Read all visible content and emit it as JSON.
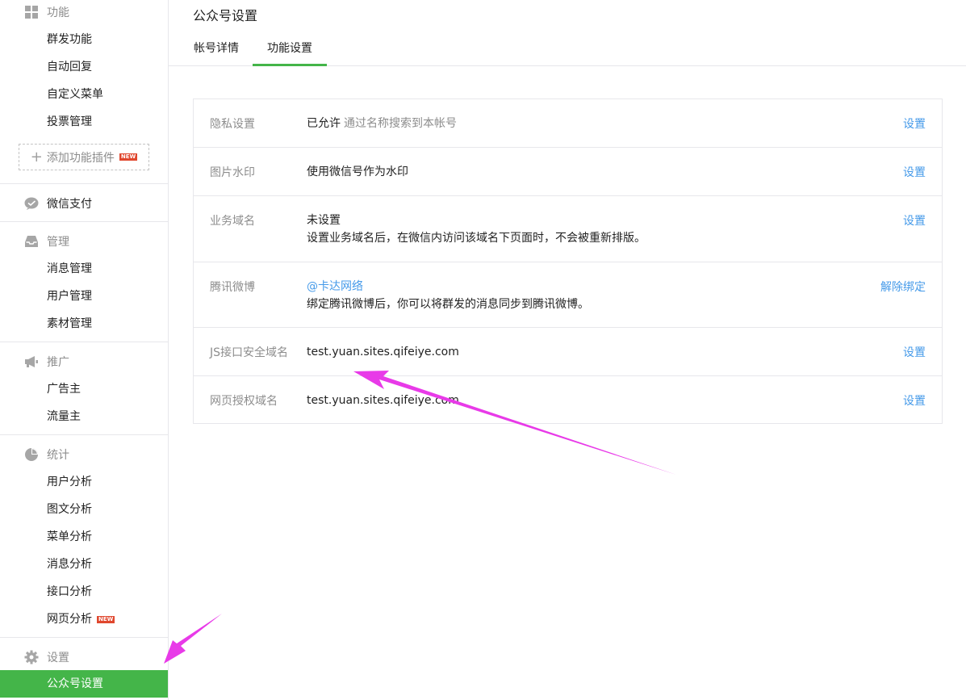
{
  "sidebar": {
    "func": {
      "title": "功能",
      "icon": "grid-icon",
      "items": [
        "群发功能",
        "自动回复",
        "自定义菜单",
        "投票管理"
      ],
      "add_plugin": "添加功能插件",
      "new_badge": "NEW"
    },
    "pay": {
      "title": "微信支付",
      "icon": "wechat-pay-icon"
    },
    "manage": {
      "title": "管理",
      "icon": "inbox-icon",
      "items": [
        "消息管理",
        "用户管理",
        "素材管理"
      ]
    },
    "promo": {
      "title": "推广",
      "icon": "megaphone-icon",
      "items": [
        "广告主",
        "流量主"
      ]
    },
    "stats": {
      "title": "统计",
      "icon": "pie-chart-icon",
      "items": [
        "用户分析",
        "图文分析",
        "菜单分析",
        "消息分析",
        "接口分析",
        "网页分析"
      ],
      "new_badge": "NEW"
    },
    "settings": {
      "title": "设置",
      "icon": "gear-icon",
      "items": [
        "公众号设置"
      ],
      "active": "公众号设置"
    }
  },
  "main": {
    "title": "公众号设置",
    "tabs": [
      {
        "label": "帐号详情",
        "active": false
      },
      {
        "label": "功能设置",
        "active": true
      }
    ],
    "rows": [
      {
        "label": "隐私设置",
        "value": "已允许",
        "hint": "通过名称搜索到本帐号",
        "action": "设置"
      },
      {
        "label": "图片水印",
        "value": "使用微信号作为水印",
        "action": "设置"
      },
      {
        "label": "业务域名",
        "value": "未设置",
        "desc": "设置业务域名后，在微信内访问该域名下页面时，不会被重新排版。",
        "action": "设置"
      },
      {
        "label": "腾讯微博",
        "value": "@卡达网络",
        "desc": "绑定腾讯微博后，你可以将群发的消息同步到腾讯微博。",
        "action": "解除绑定"
      },
      {
        "label": "JS接口安全域名",
        "value": "test.yuan.sites.qifeiye.com",
        "action": "设置"
      },
      {
        "label": "网页授权域名",
        "value": "test.yuan.sites.qifeiye.com",
        "action": "设置"
      }
    ]
  },
  "colors": {
    "accent": "#44b549",
    "link": "#459ae9",
    "muted": "#8d8d8d",
    "annotation_arrow": "#e83ae8",
    "new_badge": "#e0472e"
  }
}
